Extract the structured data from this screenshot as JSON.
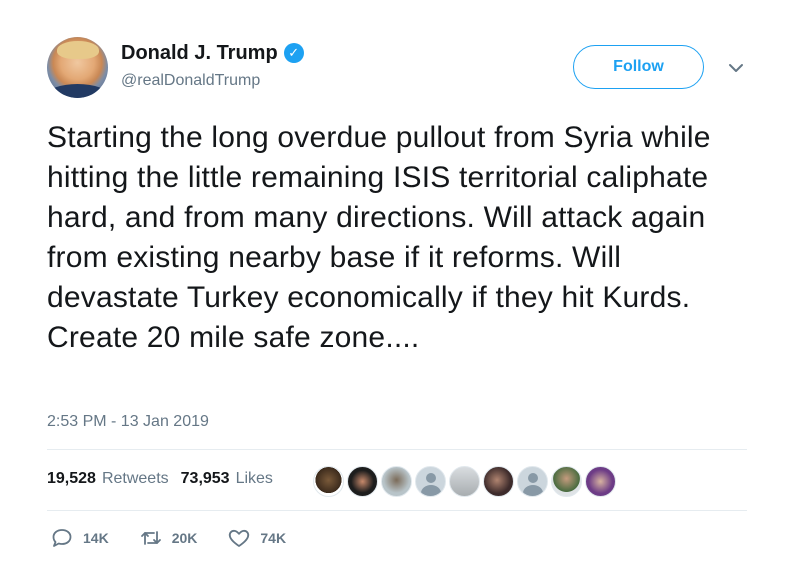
{
  "author": {
    "name": "Donald J. Trump",
    "handle": "@realDonaldTrump",
    "verified": true
  },
  "follow_button": {
    "label": "Follow"
  },
  "tweet": {
    "text": "Starting the long overdue pullout from Syria while hitting the little remaining ISIS territorial caliphate hard, and from many directions. Will attack again from existing nearby base if it reforms. Will devastate Turkey economically if they hit Kurds. Create 20 mile safe zone....",
    "timestamp": "2:53 PM - 13 Jan 2019"
  },
  "stats": {
    "retweets_count": "19,528",
    "retweets_label": "Retweets",
    "likes_count": "73,953",
    "likes_label": "Likes"
  },
  "actions": {
    "reply_count": "14K",
    "retweet_count": "20K",
    "like_count": "74K"
  },
  "colors": {
    "accent": "#1da1f2",
    "secondary_text": "#657786",
    "divider": "#e6ecf0"
  }
}
